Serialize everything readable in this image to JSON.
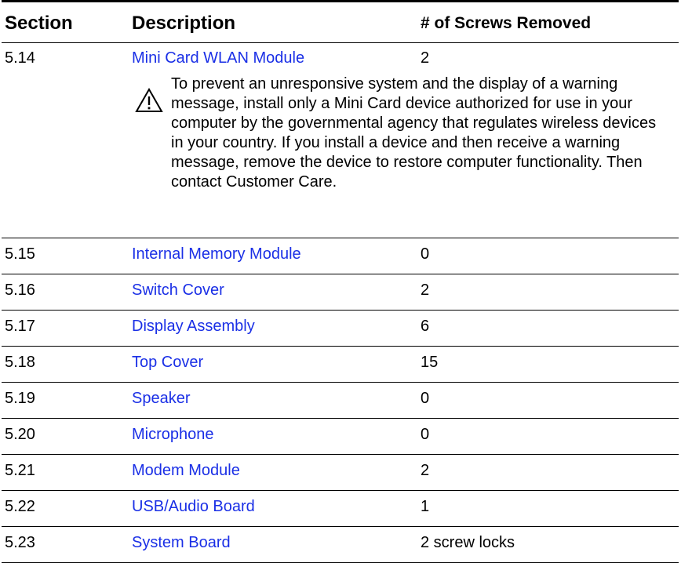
{
  "headers": {
    "section": "Section",
    "description": "Description",
    "screws": "# of Screws Removed"
  },
  "rows": [
    {
      "section": "5.14",
      "description": "Mini Card WLAN Module",
      "screws": "2"
    },
    {
      "section": "5.15",
      "description": "Internal Memory Module",
      "screws": "0"
    },
    {
      "section": "5.16",
      "description": "Switch Cover",
      "screws": "2"
    },
    {
      "section": "5.17",
      "description": "Display Assembly",
      "screws": "6"
    },
    {
      "section": "5.18",
      "description": "Top Cover",
      "screws": "15"
    },
    {
      "section": "5.19",
      "description": "Speaker",
      "screws": "0"
    },
    {
      "section": "5.20",
      "description": "Microphone",
      "screws": "0"
    },
    {
      "section": "5.21",
      "description": "Modem Module",
      "screws": "2"
    },
    {
      "section": "5.22",
      "description": "USB/Audio Board",
      "screws": "1"
    },
    {
      "section": "5.23",
      "description": "System Board",
      "screws": "2 screw locks"
    }
  ],
  "warning": {
    "icon": "warning-triangle-icon",
    "text": "To prevent an unresponsive system and the display of a warning message, install only a Mini Card device authorized for use in your computer by the governmental agency that regulates wireless devices in your country. If you install a device and then receive a warning message, remove the device to restore computer functionality. Then contact Customer Care."
  },
  "colors": {
    "link": "#1a2fe6",
    "rule": "#000000"
  }
}
